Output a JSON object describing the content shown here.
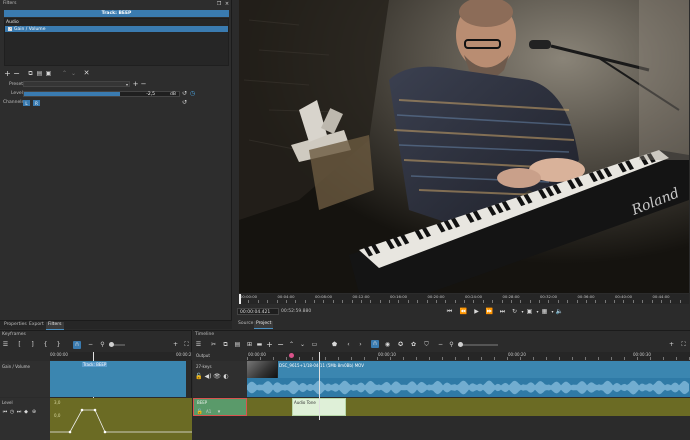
{
  "filters": {
    "panel_title": "Filters",
    "track_label": "Track: BEEP",
    "section_audio": "Audio",
    "filter_items": [
      {
        "name": "Gain / Volume"
      }
    ],
    "preset_label": "Preset",
    "level_label": "Level",
    "level_value": "-2,5",
    "level_unit": "dB",
    "level_fraction": 0.62,
    "channels_label": "Channels",
    "channel_l": "L",
    "channel_r": "R"
  },
  "left_tabs": [
    "Properties",
    "Export",
    "Filters"
  ],
  "keyframes": {
    "panel_title": "Keyframes",
    "ruler": [
      "00:00:00",
      "00:00:2"
    ],
    "clip_label": "Track: BEEP",
    "track_gain": "Gain / Volume",
    "track_level": "Level",
    "level_ticks": [
      "3,0",
      "0,0"
    ]
  },
  "player": {
    "ruler": [
      "00:00:00",
      "00:04:00",
      "00:08:00",
      "00:12:00",
      "00:16:00",
      "00:20:00",
      "00:24:00",
      "00:28:00",
      "00:32:00",
      "00:36:00",
      "00:40:00",
      "00:44:00"
    ],
    "position": "00:00:04.421",
    "duration": "00:52:59.880",
    "tab_source": "Source",
    "tab_project": "Project",
    "zoom_options": "≡"
  },
  "timeline": {
    "panel_title": "Timeline",
    "ruler": [
      "00:00:00",
      "00:00:10",
      "00:00:20",
      "00:00:30"
    ],
    "output_label": "Output",
    "v1_label": "27-keys",
    "v1_clip": "DSC_9615+1/18-04-11 (5Mb 8m0Bb) MOV",
    "a1_label": "BEEP",
    "a1_clip": "Audio Tone",
    "a1_btn": "A1"
  },
  "colors": {
    "accent": "#3a7bb0",
    "audio_track": "#3b86b0",
    "keyframe_track": "#6b6b24",
    "selection": "#2c5a7c"
  }
}
